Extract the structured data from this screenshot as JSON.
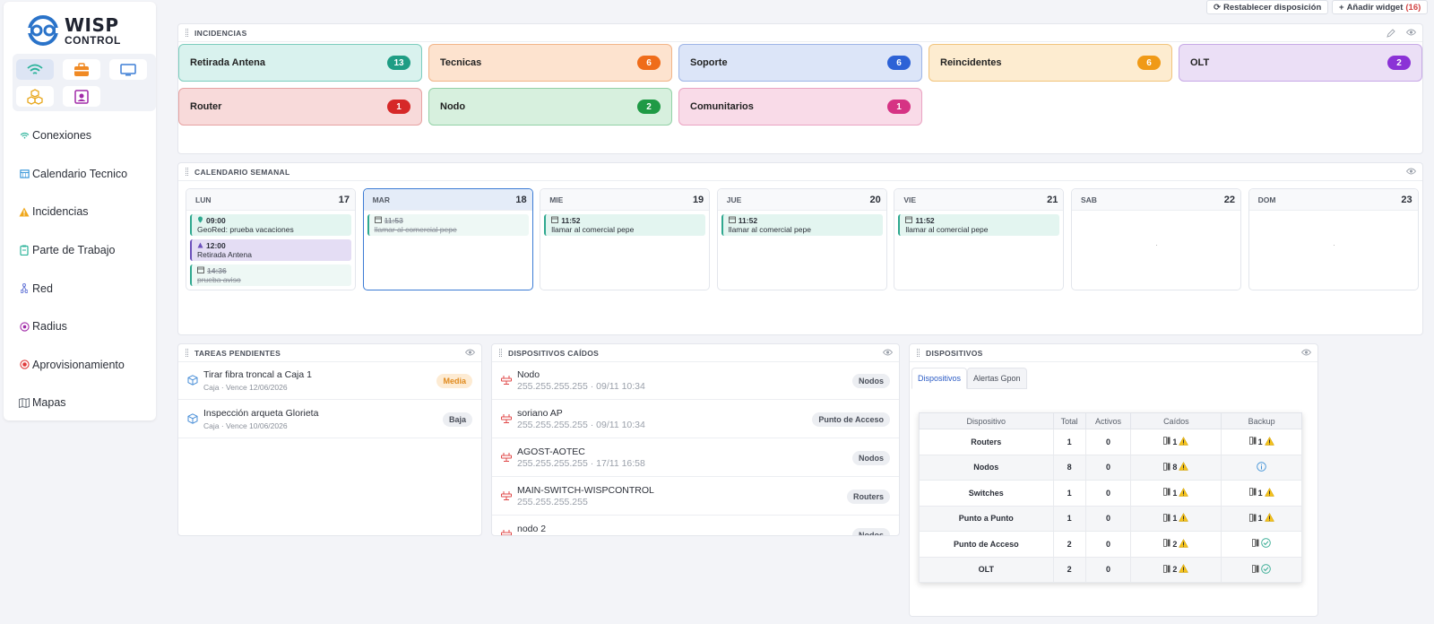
{
  "brand": {
    "line1": "WISP",
    "line2": "CONTROL"
  },
  "nav": [
    {
      "label": "Conexiones",
      "icon": "wifi-icon"
    },
    {
      "label": "Calendario Tecnico",
      "icon": "calendar-icon"
    },
    {
      "label": "Incidencias",
      "icon": "warning-icon"
    },
    {
      "label": "Parte de Trabajo",
      "icon": "clipboard-icon"
    },
    {
      "label": "Red",
      "icon": "network-icon"
    },
    {
      "label": "Radius",
      "icon": "radius-icon"
    },
    {
      "label": "Aprovisionamiento",
      "icon": "provision-icon"
    },
    {
      "label": "Mapas",
      "icon": "map-icon"
    }
  ],
  "toolbar": {
    "reset_label": "Restablecer disposición",
    "add_label": "Añadir widget",
    "add_count": "(16)"
  },
  "incidencias": {
    "title": "INCIDENCIAS",
    "cards": [
      {
        "label": "Retirada Antena",
        "count": "13",
        "bg": "#d9f2ee",
        "border": "#7cccbd",
        "badge": "#1f9d84"
      },
      {
        "label": "Tecnicas",
        "count": "6",
        "bg": "#fde3cf",
        "border": "#f2b488",
        "badge": "#ef6c1a"
      },
      {
        "label": "Soporte",
        "count": "6",
        "bg": "#dce5f8",
        "border": "#9db4e6",
        "badge": "#2d62d6"
      },
      {
        "label": "Reincidentes",
        "count": "6",
        "bg": "#fdecd0",
        "border": "#f1c47c",
        "badge": "#f09a16"
      },
      {
        "label": "OLT",
        "count": "2",
        "bg": "#ebdff6",
        "border": "#c7a9e6",
        "badge": "#8b32d6"
      },
      {
        "label": "Router",
        "count": "1",
        "bg": "#f8dada",
        "border": "#e6a2a2",
        "badge": "#d62828"
      },
      {
        "label": "Nodo",
        "count": "2",
        "bg": "#d7f0de",
        "border": "#93d1a6",
        "badge": "#1f9a45"
      },
      {
        "label": "Comunitarios",
        "count": "1",
        "bg": "#f9dbe8",
        "border": "#eaa3c2",
        "badge": "#d63384"
      }
    ]
  },
  "calendario": {
    "title": "CALENDARIO SEMANAL",
    "days": [
      {
        "name": "LUN",
        "num": "17",
        "events": [
          {
            "time": "09:00",
            "desc": "GeoRed: prueba vacaciones",
            "style": "green",
            "icon": "pin-icon"
          },
          {
            "time": "12:00",
            "desc": "Retirada Antena",
            "style": "purple",
            "icon": "triangle-icon"
          },
          {
            "time": "14:36",
            "desc": "prueba aviso",
            "style": "done",
            "icon": "calendar-small-icon"
          }
        ]
      },
      {
        "name": "MAR",
        "num": "18",
        "today": true,
        "events": [
          {
            "time": "11:53",
            "desc": "llamar al comercial pepe",
            "style": "done",
            "icon": "calendar-small-icon"
          }
        ]
      },
      {
        "name": "MIE",
        "num": "19",
        "events": [
          {
            "time": "11:52",
            "desc": "llamar al comercial pepe",
            "style": "green",
            "icon": "calendar-small-icon"
          }
        ]
      },
      {
        "name": "JUE",
        "num": "20",
        "events": [
          {
            "time": "11:52",
            "desc": "llamar al comercial pepe",
            "style": "green",
            "icon": "calendar-small-icon"
          }
        ]
      },
      {
        "name": "VIE",
        "num": "21",
        "events": [
          {
            "time": "11:52",
            "desc": "llamar al comercial pepe",
            "style": "green",
            "icon": "calendar-small-icon"
          }
        ]
      },
      {
        "name": "SAB",
        "num": "22",
        "events": []
      },
      {
        "name": "DOM",
        "num": "23",
        "events": []
      }
    ]
  },
  "tareas": {
    "title": "TAREAS PENDIENTES",
    "items": [
      {
        "title": "Tirar fibra troncal a Caja 1",
        "sub": "Caja · Vence 12/06/2026",
        "priority": "Media",
        "style": "media"
      },
      {
        "title": "Inspección arqueta Glorieta",
        "sub": "Caja · Vence 10/06/2026",
        "priority": "Baja",
        "style": "baja"
      }
    ]
  },
  "caidos": {
    "title": "DISPOSITIVOS CAÍDOS",
    "items": [
      {
        "name": "Nodo",
        "sub": "255.255.255.255 · 09/11 10:34",
        "type": "Nodos"
      },
      {
        "name": "soriano AP",
        "sub": "255.255.255.255 · 09/11 10:34",
        "type": "Punto de Acceso"
      },
      {
        "name": "AGOST-AOTEC",
        "sub": "255.255.255.255 · 17/11 16:58",
        "type": "Nodos"
      },
      {
        "name": "MAIN-SWITCH-WISPCONTROL",
        "sub": "255.255.255.255",
        "type": "Routers"
      },
      {
        "name": "nodo 2",
        "sub": "",
        "type": "Nodos"
      }
    ]
  },
  "dispositivos": {
    "title": "DISPOSITIVOS",
    "tabs": [
      "Dispositivos",
      "Alertas Gpon"
    ],
    "headers": [
      "Dispositivo",
      "Total",
      "Activos",
      "Caídos",
      "Backup"
    ],
    "rows": [
      {
        "name": "Routers",
        "total": "1",
        "activos": "0",
        "caidos": "1",
        "backup": "1",
        "backup_state": "warn"
      },
      {
        "name": "Nodos",
        "total": "8",
        "activos": "0",
        "caidos": "8",
        "backup": "",
        "backup_state": "info"
      },
      {
        "name": "Switches",
        "total": "1",
        "activos": "0",
        "caidos": "1",
        "backup": "1",
        "backup_state": "warn"
      },
      {
        "name": "Punto a Punto",
        "total": "1",
        "activos": "0",
        "caidos": "1",
        "backup": "1",
        "backup_state": "warn"
      },
      {
        "name": "Punto de Acceso",
        "total": "2",
        "activos": "0",
        "caidos": "2",
        "backup": "",
        "backup_state": "ok"
      },
      {
        "name": "OLT",
        "total": "2",
        "activos": "0",
        "caidos": "2",
        "backup": "",
        "backup_state": "ok"
      }
    ]
  }
}
